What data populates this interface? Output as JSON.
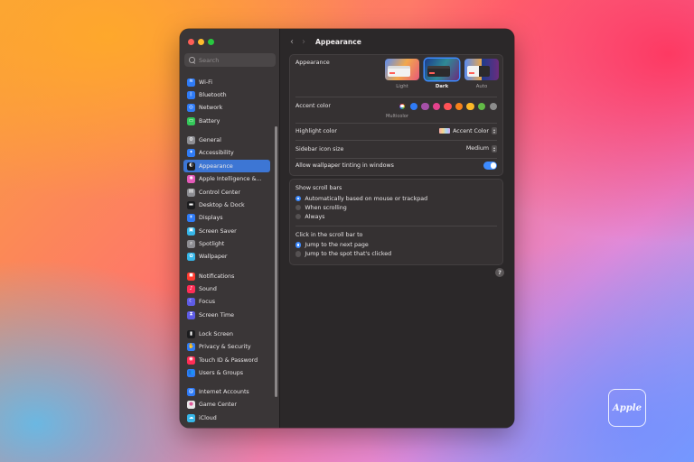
{
  "sidebar": {
    "search_placeholder": "Search",
    "items": [
      {
        "label": "Wi-Fi",
        "icon": "wifi-icon",
        "color": "#2f7bf6",
        "glyph": "≋"
      },
      {
        "label": "Bluetooth",
        "icon": "bluetooth-icon",
        "color": "#2f7bf6",
        "glyph": "ᛒ"
      },
      {
        "label": "Network",
        "icon": "globe-icon",
        "color": "#2f7bf6",
        "glyph": "◎"
      },
      {
        "label": "Battery",
        "icon": "battery-icon",
        "color": "#34c759",
        "glyph": "▭"
      },
      {
        "label": "General",
        "icon": "gear-icon",
        "color": "#8e8e93",
        "glyph": "⚙"
      },
      {
        "label": "Accessibility",
        "icon": "accessibility-icon",
        "color": "#2f7bf6",
        "glyph": "✦"
      },
      {
        "label": "Appearance",
        "icon": "appearance-icon",
        "color": "#1c1c1e",
        "glyph": "◐"
      },
      {
        "label": "Apple Intelligence &...",
        "icon": "apple-intelligence-icon",
        "color": "#e45ab8",
        "glyph": "✺"
      },
      {
        "label": "Control Center",
        "icon": "control-center-icon",
        "color": "#8e8e93",
        "glyph": "▤"
      },
      {
        "label": "Desktop & Dock",
        "icon": "dock-icon",
        "color": "#1c1c1e",
        "glyph": "▬"
      },
      {
        "label": "Displays",
        "icon": "displays-icon",
        "color": "#2f7bf6",
        "glyph": "☀"
      },
      {
        "label": "Screen Saver",
        "icon": "screen-saver-icon",
        "color": "#36b6e8",
        "glyph": "▣"
      },
      {
        "label": "Spotlight",
        "icon": "spotlight-icon",
        "color": "#8e8e93",
        "glyph": "⌕"
      },
      {
        "label": "Wallpaper",
        "icon": "wallpaper-icon",
        "color": "#36b6e8",
        "glyph": "✿"
      },
      {
        "label": "Notifications",
        "icon": "notifications-icon",
        "color": "#ff3b30",
        "glyph": "◼"
      },
      {
        "label": "Sound",
        "icon": "sound-icon",
        "color": "#ff2d55",
        "glyph": "♪"
      },
      {
        "label": "Focus",
        "icon": "focus-icon",
        "color": "#5e5ce6",
        "glyph": "☾"
      },
      {
        "label": "Screen Time",
        "icon": "screen-time-icon",
        "color": "#5e5ce6",
        "glyph": "⧗"
      },
      {
        "label": "Lock Screen",
        "icon": "lock-screen-icon",
        "color": "#1c1c1e",
        "glyph": "▮"
      },
      {
        "label": "Privacy & Security",
        "icon": "privacy-hand-icon",
        "color": "#2f7bf6",
        "glyph": "✋"
      },
      {
        "label": "Touch ID & Password",
        "icon": "fingerprint-icon",
        "color": "#ff2d55",
        "glyph": "◉"
      },
      {
        "label": "Users & Groups",
        "icon": "users-icon",
        "color": "#2f7bf6",
        "glyph": "👥"
      },
      {
        "label": "Internet Accounts",
        "icon": "at-sign-icon",
        "color": "#2f7bf6",
        "glyph": "@"
      },
      {
        "label": "Game Center",
        "icon": "game-center-icon",
        "color": "#e8e8e8",
        "glyph": "●"
      },
      {
        "label": "iCloud",
        "icon": "cloud-icon",
        "color": "#36b6e8",
        "glyph": "☁"
      }
    ],
    "active_index": 6,
    "gaps_after": [
      3,
      13,
      17,
      21
    ]
  },
  "toolbar": {
    "title": "Appearance"
  },
  "appearance": {
    "label": "Appearance",
    "options": [
      "Light",
      "Dark",
      "Auto"
    ],
    "selected": "Dark"
  },
  "accent": {
    "label": "Accent color",
    "colors": [
      "multicolor",
      "#2f7bf6",
      "#a550a7",
      "#e4428d",
      "#ff5257",
      "#f7821b",
      "#fcb827",
      "#62ba46",
      "#8c8c8c"
    ],
    "selected_label": "Multicolor"
  },
  "highlight": {
    "label": "Highlight color",
    "value": "Accent Color"
  },
  "sidebar_icon_size": {
    "label": "Sidebar icon size",
    "value": "Medium"
  },
  "wallpaper_tinting": {
    "label": "Allow wallpaper tinting in windows",
    "enabled": true
  },
  "scroll_bars": {
    "label": "Show scroll bars",
    "options": [
      "Automatically based on mouse or trackpad",
      "When scrolling",
      "Always"
    ],
    "selected": 0
  },
  "scroll_click": {
    "label": "Click in the scroll bar to",
    "options": [
      "Jump to the next page",
      "Jump to the spot that's clicked"
    ],
    "selected": 0
  },
  "help_glyph": "?",
  "watermark": "Apple",
  "colors": {
    "traffic_red": "#fe5f57",
    "traffic_yellow": "#febc2e",
    "traffic_green": "#28c840",
    "accent_blue": "#3d8bff"
  }
}
